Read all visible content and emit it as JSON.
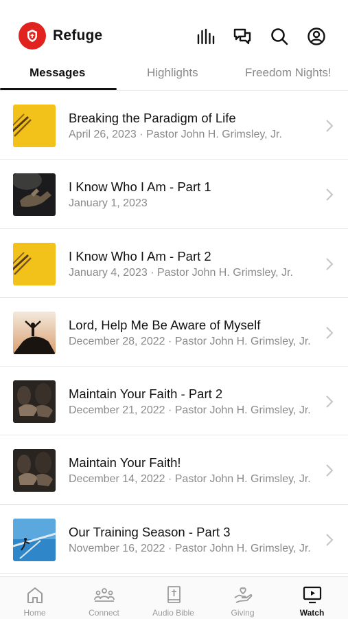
{
  "app": {
    "title": "Refuge"
  },
  "header_icons": [
    "audio-bars-icon",
    "chat-icon",
    "search-icon",
    "profile-icon"
  ],
  "tabs": [
    {
      "label": "Messages",
      "active": true
    },
    {
      "label": "Highlights",
      "active": false
    },
    {
      "label": "Freedom Nights!",
      "active": false
    }
  ],
  "messages": [
    {
      "title": "Breaking the Paradigm of Life",
      "subtitle": "April 26, 2023 · Pastor John H. Grimsley, Jr.",
      "thumb": "yellow-slash"
    },
    {
      "title": "I Know Who I Am - Part 1",
      "subtitle": "January 1, 2023",
      "thumb": "dark-hands"
    },
    {
      "title": "I Know Who I Am - Part 2",
      "subtitle": "January 4, 2023 · Pastor John H. Grimsley, Jr.",
      "thumb": "yellow-slash"
    },
    {
      "title": "Lord, Help Me Be Aware of Myself",
      "subtitle": "December 28, 2022 · Pastor John H. Grimsley, Jr.",
      "thumb": "sunset-silhouette"
    },
    {
      "title": "Maintain Your Faith - Part 2",
      "subtitle": "December 21, 2022 · Pastor John H. Grimsley, Jr.",
      "thumb": "praying-people"
    },
    {
      "title": "Maintain Your Faith!",
      "subtitle": "December 14, 2022 · Pastor John H. Grimsley, Jr.",
      "thumb": "praying-people"
    },
    {
      "title": "Our Training Season - Part 3",
      "subtitle": "November 16, 2022 · Pastor John H. Grimsley, Jr.",
      "thumb": "blue-hurdle"
    }
  ],
  "tabbar": [
    {
      "label": "Home",
      "icon": "home-icon",
      "active": false
    },
    {
      "label": "Connect",
      "icon": "group-icon",
      "active": false
    },
    {
      "label": "Audio Bible",
      "icon": "bible-icon",
      "active": false
    },
    {
      "label": "Giving",
      "icon": "giving-hand-icon",
      "active": false
    },
    {
      "label": "Watch",
      "icon": "tv-play-icon",
      "active": true
    }
  ],
  "colors": {
    "brand": "#e0231f",
    "accent_yellow": "#f2c21b",
    "muted_text": "#8a8a8a"
  }
}
